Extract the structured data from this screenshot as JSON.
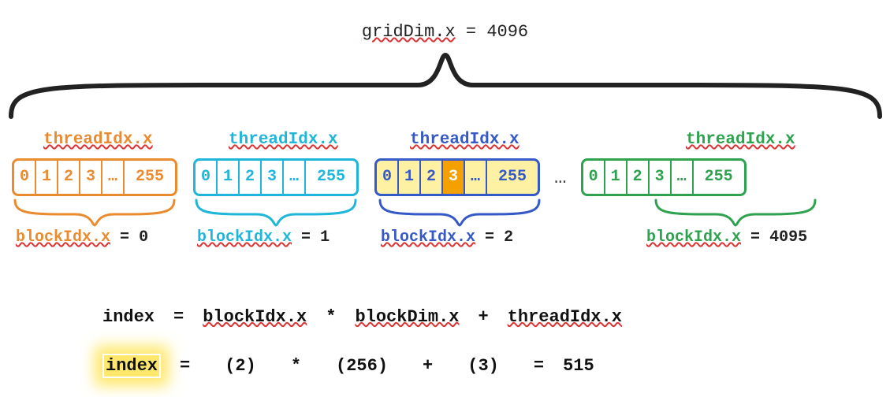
{
  "gridDim": {
    "label": "gridDim.x",
    "value": "4096"
  },
  "threadIdxLabel": "threadIdx.x",
  "blockIdxLabel": "blockIdx.x",
  "blocks": [
    {
      "color": "orange",
      "threadIdxColor": "orange",
      "cells": [
        "0",
        "1",
        "2",
        "3",
        "…",
        "255"
      ],
      "blockIdx": "0",
      "highlight": false,
      "highlightCell": null
    },
    {
      "color": "cyan",
      "threadIdxColor": "cyan",
      "cells": [
        "0",
        "1",
        "2",
        "3",
        "…",
        "255"
      ],
      "blockIdx": "1",
      "highlight": false,
      "highlightCell": null
    },
    {
      "color": "blue",
      "threadIdxColor": "blue",
      "cells": [
        "0",
        "1",
        "2",
        "3",
        "…",
        "255"
      ],
      "blockIdx": "2",
      "highlight": true,
      "highlightCell": 3
    },
    {
      "color": "green",
      "threadIdxColor": "green",
      "cells": [
        "0",
        "1",
        "2",
        "3",
        "…",
        "255"
      ],
      "blockIdx": "4095",
      "highlight": false,
      "highlightCell": null
    }
  ],
  "ellipsis": "…",
  "formula": {
    "lhs": "index",
    "eq": "=",
    "terms": [
      "blockIdx.x",
      "*",
      "blockDim.x",
      "+",
      "threadIdx.x"
    ],
    "example": {
      "lhs": "index",
      "tokens": [
        "=",
        "(2)",
        "*",
        "(256)",
        "+",
        "(3)",
        "=",
        "515"
      ]
    }
  }
}
